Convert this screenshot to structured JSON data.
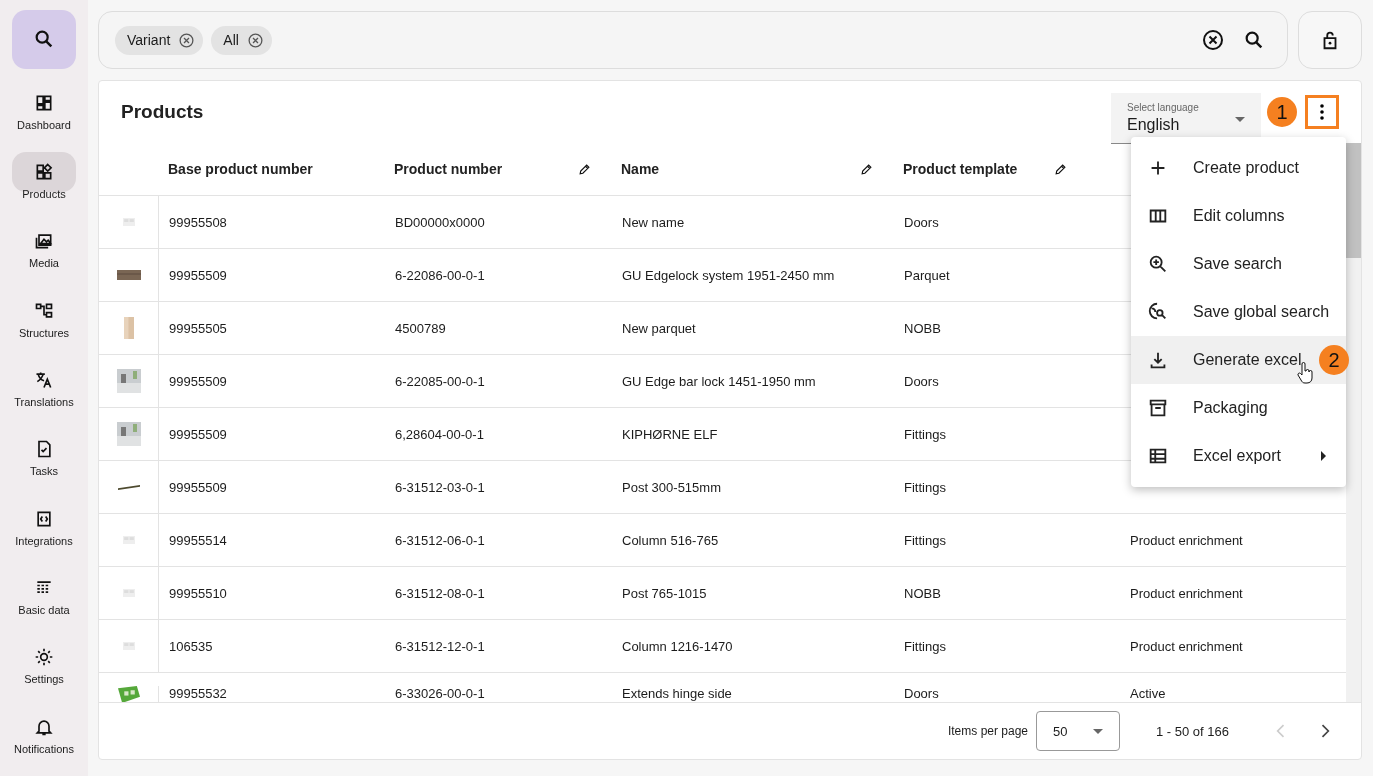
{
  "sidebar": {
    "items": [
      {
        "label": "Dashboard",
        "selected": false
      },
      {
        "label": "Products",
        "selected": true
      },
      {
        "label": "Media",
        "selected": false
      },
      {
        "label": "Structures",
        "selected": false
      },
      {
        "label": "Translations",
        "selected": false
      },
      {
        "label": "Tasks",
        "selected": false
      },
      {
        "label": "Integrations",
        "selected": false
      },
      {
        "label": "Basic data",
        "selected": false
      },
      {
        "label": "Settings",
        "selected": false
      },
      {
        "label": "Notifications",
        "selected": false
      }
    ]
  },
  "search": {
    "chips": [
      "Variant",
      "All"
    ]
  },
  "panel": {
    "title": "Products",
    "language": {
      "label": "Select language",
      "value": "English"
    },
    "step_badges": [
      "1",
      "2"
    ]
  },
  "table": {
    "columns": [
      {
        "label": "Base product number",
        "editable": false
      },
      {
        "label": "Product number",
        "editable": true
      },
      {
        "label": "Name",
        "editable": true
      },
      {
        "label": "Product template",
        "editable": true
      }
    ],
    "rows": [
      {
        "cells": [
          "99955508",
          "BD00000x0000",
          "New name",
          "Doors",
          ""
        ]
      },
      {
        "cells": [
          "99955509",
          "6-22086-00-0-1",
          "GU Edgelock system 1951-2450 mm",
          "Parquet",
          ""
        ]
      },
      {
        "cells": [
          "99955505",
          "4500789",
          "New parquet",
          "NOBB",
          ""
        ]
      },
      {
        "cells": [
          "99955509",
          "6-22085-00-0-1",
          "GU Edge bar lock 1451-1950 mm",
          "Doors",
          ""
        ]
      },
      {
        "cells": [
          "99955509",
          "6,28604-00-0-1",
          "KIPHØRNE ELF",
          "Fittings",
          ""
        ]
      },
      {
        "cells": [
          "99955509",
          "6-31512-03-0-1",
          "Post 300-515mm",
          "Fittings",
          ""
        ]
      },
      {
        "cells": [
          "99955514",
          "6-31512-06-0-1",
          "Column 516-765",
          "Fittings",
          "Product enrichment"
        ]
      },
      {
        "cells": [
          "99955510",
          "6-31512-08-0-1",
          "Post 765-1015",
          "NOBB",
          "Product enrichment"
        ]
      },
      {
        "cells": [
          "106535",
          "6-31512-12-0-1",
          "Column 1216-1470",
          "Fittings",
          "Product enrichment"
        ]
      },
      {
        "cells": [
          "99955532",
          "6-33026-00-0-1",
          "Extends hinge side",
          "Doors",
          "Active"
        ]
      }
    ]
  },
  "menu": {
    "items": [
      {
        "label": "Create product",
        "highlighted": false,
        "submenu": false
      },
      {
        "label": "Edit columns",
        "highlighted": false,
        "submenu": false
      },
      {
        "label": "Save search",
        "highlighted": false,
        "submenu": false
      },
      {
        "label": "Save global search",
        "highlighted": false,
        "submenu": false
      },
      {
        "label": "Generate excel",
        "highlighted": true,
        "submenu": false
      },
      {
        "label": "Packaging",
        "highlighted": false,
        "submenu": false
      },
      {
        "label": "Excel export",
        "highlighted": false,
        "submenu": true
      }
    ]
  },
  "paginator": {
    "label": "Items per page",
    "page_size": "50",
    "range": "1 - 50 of 166",
    "prev_disabled": true,
    "next_disabled": false
  }
}
